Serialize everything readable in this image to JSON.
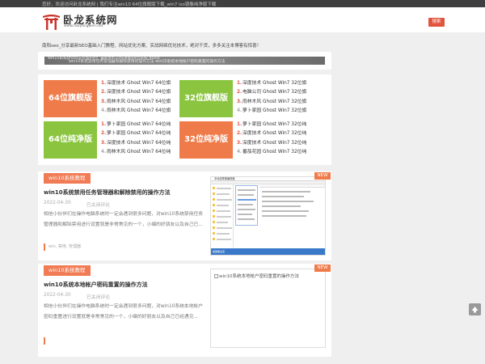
{
  "topbar": {
    "message": "您好，欢迎访问卧龙系统网 | 我们专注win10 64位旗舰版下载_win7 iso镜像纯净版下载"
  },
  "header": {
    "logo_text": "卧龙系统网",
    "logo_url": "www.raoyangwen.net",
    "search_label": "搜索"
  },
  "notice": "南阳seo_分享最新SEO基础入门教程、网站优化方案、实战网络优化技术，绝对干货，多多关注本博客有惊喜！",
  "banner": {
    "line1": "win10系统ghost安装版64位_最新win10纯净版64位系统 ghost",
    "line2": "win10系统禁用任务管理器和解除禁用的操作方法 win10系统本地帐户密码重置的操作方法"
  },
  "downloads": {
    "block_64_flagship": "64位旗舰版",
    "block_32_flagship": "32位旗舰版",
    "block_64_pure": "64位纯净版",
    "block_32_pure": "32位纯净版",
    "list_64_flagship": [
      {
        "num": "1.",
        "text": "深度技术 Ghost Win7 64位旗"
      },
      {
        "num": "2.",
        "text": "深度技术 Ghost Win7 64位旗"
      },
      {
        "num": "3.",
        "text": "雨林木风 Ghost Win7 64位旗"
      },
      {
        "num": "4.",
        "text": "雨林木风 Ghost Win7 64位旗"
      }
    ],
    "list_32_flagship": [
      {
        "num": "1.",
        "text": "深度技术 Ghost Win7 32位旗"
      },
      {
        "num": "2.",
        "text": "电脑公司 Ghost Win7 32位旗"
      },
      {
        "num": "3.",
        "text": "雨林木风 Ghost Win7 32位旗"
      },
      {
        "num": "4.",
        "text": "萝卜家园 Ghost Win7 32位旗"
      }
    ],
    "list_64_pure": [
      {
        "num": "1.",
        "text": "萝卜家园 Ghost Win7 64位纯"
      },
      {
        "num": "2.",
        "text": "萝卜家园 Ghost Win7 64位纯"
      },
      {
        "num": "3.",
        "text": "深度技术 Ghost Win7 64位纯"
      },
      {
        "num": "4.",
        "text": "雨林木风 Ghost Win7 64位纯"
      }
    ],
    "list_32_pure": [
      {
        "num": "1.",
        "text": "萝卜家园 Ghost Win7 32位纯"
      },
      {
        "num": "2.",
        "text": "深度技术 Ghost Win7 32位纯"
      },
      {
        "num": "3.",
        "text": "深度技术 Ghost Win7 32位纯"
      },
      {
        "num": "4.",
        "text": "番茄花园 Ghost Win7 32位纯"
      }
    ]
  },
  "posts": [
    {
      "category": "win10系统教程",
      "title": "win10系统禁用任务管理器和解除禁用的操作方法",
      "date": "2022-04-30",
      "comments": "已关闭评论",
      "excerpt": "相信小伙伴们在操作电脑系统时一定会遇到很多问题，对win10系统禁用任务管理器和解除禁用进行设置就是非常常见的一个，小编的好朋友以及自己已...",
      "tags": "win, 禁用, 管理器",
      "badge": "NEW",
      "thumb_title": "本地组策略编辑器",
      "thumb_status": "组策略设置"
    },
    {
      "category": "win10系统教程",
      "title": "win10系统本地帐户密码重置的操作方法",
      "date": "2022-04-30",
      "comments": "已关闭评论",
      "excerpt": "相信小伙伴们在操作电脑系统时一定会遇到很多问题，对win10系统本地帐户密码重置进行设置就是非常常见的一个，小编的好朋友以及自己已经遇见...",
      "badge": "NEW",
      "thumb_alt": "win10系统本地帐户密码重置的操作方法"
    }
  ],
  "colors": {
    "accent_orange": "#f07b4a",
    "accent_green": "#8bc53f",
    "search_red": "#e2543d",
    "topbar_dark": "#3f3f3f"
  }
}
